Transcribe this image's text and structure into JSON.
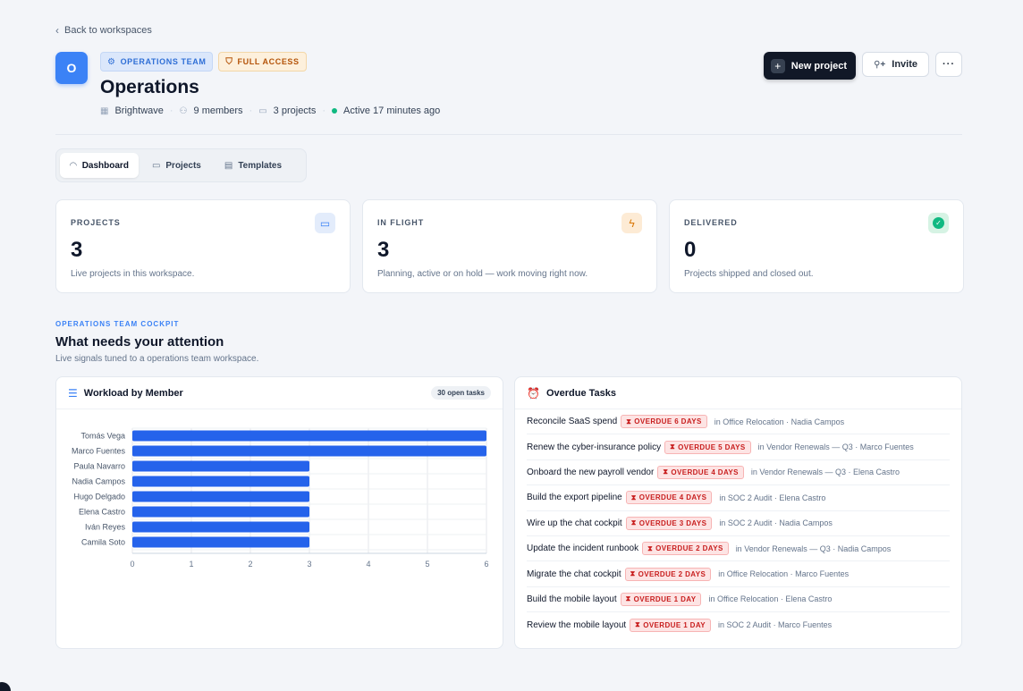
{
  "nav": {
    "back_label": "Back to workspaces"
  },
  "workspace": {
    "avatar_letter": "O",
    "team_badge": "OPERATIONS TEAM",
    "access_badge": "FULL ACCESS",
    "title": "Operations",
    "org": "Brightwave",
    "members": "9 members",
    "projects": "3 projects",
    "activity": "Active 17 minutes ago"
  },
  "actions": {
    "new_project": "New project",
    "invite": "Invite",
    "more": "···"
  },
  "tabs": [
    {
      "label": "Dashboard",
      "icon": "gauge-icon",
      "active": true
    },
    {
      "label": "Projects",
      "icon": "folder-icon",
      "active": false
    },
    {
      "label": "Templates",
      "icon": "archive-icon",
      "active": false
    }
  ],
  "stats": [
    {
      "label": "PROJECTS",
      "value": "3",
      "desc": "Live projects in this workspace.",
      "icon": "folder-icon"
    },
    {
      "label": "IN FLIGHT",
      "value": "3",
      "desc": "Planning, active or on hold — work moving right now.",
      "icon": "bolt-icon"
    },
    {
      "label": "DELIVERED",
      "value": "0",
      "desc": "Projects shipped and closed out.",
      "icon": "check-circle-icon"
    }
  ],
  "section": {
    "eyebrow": "OPERATIONS TEAM COCKPIT",
    "title": "What needs your attention",
    "subtitle": "Live signals tuned to a operations team workspace."
  },
  "workload": {
    "title": "Workload by Member",
    "pill": "30 open tasks",
    "bar_color": "#2563eb"
  },
  "chart_data": {
    "type": "bar",
    "orientation": "horizontal",
    "categories": [
      "Tomás Vega",
      "Marco Fuentes",
      "Paula Navarro",
      "Nadia Campos",
      "Hugo Delgado",
      "Elena Castro",
      "Iván Reyes",
      "Camila Soto"
    ],
    "values": [
      6,
      6,
      3,
      3,
      3,
      3,
      3,
      3
    ],
    "xlim": [
      0,
      6
    ],
    "xticks": [
      "0",
      "1",
      "2",
      "3",
      "4",
      "5",
      "6"
    ],
    "grid": true
  },
  "overdue": {
    "title": "Overdue Tasks",
    "tasks": [
      {
        "name": "Reconcile SaaS spend",
        "badge": "OVERDUE 6 DAYS",
        "context": "in Office Relocation · Nadia Campos"
      },
      {
        "name": "Renew the cyber-insurance policy",
        "badge": "OVERDUE 5 DAYS",
        "context": "in Vendor Renewals — Q3 · Marco Fuentes"
      },
      {
        "name": "Onboard the new payroll vendor",
        "badge": "OVERDUE 4 DAYS",
        "context": "in Vendor Renewals — Q3 · Elena Castro"
      },
      {
        "name": "Build the export pipeline",
        "badge": "OVERDUE 4 DAYS",
        "context": "in SOC 2 Audit · Elena Castro"
      },
      {
        "name": "Wire up the chat cockpit",
        "badge": "OVERDUE 3 DAYS",
        "context": "in SOC 2 Audit · Nadia Campos"
      },
      {
        "name": "Update the incident runbook",
        "badge": "OVERDUE 2 DAYS",
        "context": "in Vendor Renewals — Q3 · Nadia Campos"
      },
      {
        "name": "Migrate the chat cockpit",
        "badge": "OVERDUE 2 DAYS",
        "context": "in Office Relocation · Marco Fuentes"
      },
      {
        "name": "Build the mobile layout",
        "badge": "OVERDUE 1 DAY",
        "context": "in Office Relocation · Elena Castro"
      },
      {
        "name": "Review the mobile layout",
        "badge": "OVERDUE 1 DAY",
        "context": "in SOC 2 Audit · Marco Fuentes"
      }
    ]
  }
}
